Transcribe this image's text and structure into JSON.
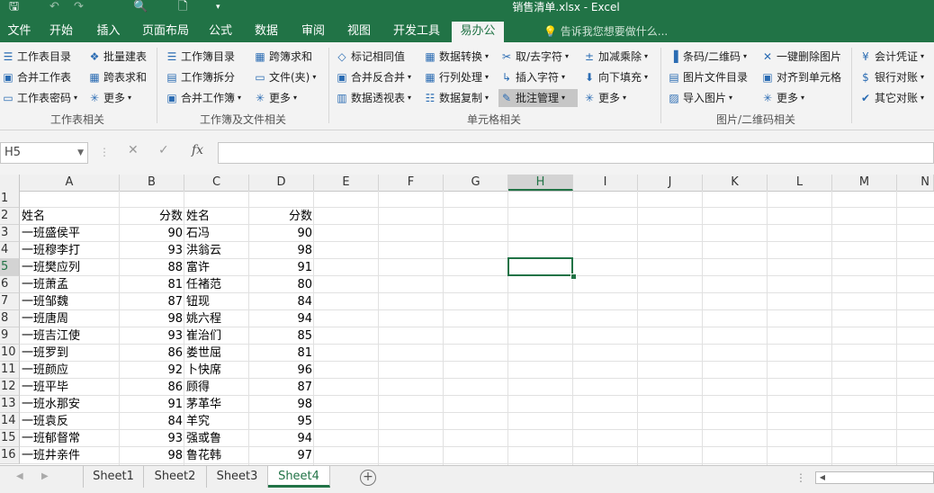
{
  "window": {
    "title": "销售清单.xlsx - Excel"
  },
  "quick_access": [
    "save-icon",
    "undo-icon",
    "redo-icon",
    "print-preview-icon",
    "new-file-icon",
    "customize-icon"
  ],
  "tabs": [
    "文件",
    "开始",
    "插入",
    "页面布局",
    "公式",
    "数据",
    "审阅",
    "视图",
    "开发工具",
    "易办公"
  ],
  "active_tab": "易办公",
  "tell_me": "告诉我您想要做什么...",
  "ribbon": {
    "group1": {
      "label": "工作表相关",
      "items": [
        "工作表目录",
        "批量建表",
        "合并工作表",
        "跨表求和",
        "工作表密码",
        "更多"
      ]
    },
    "group2": {
      "label": "工作簿及文件相关",
      "items": [
        "工作簿目录",
        "跨簿求和",
        "工作簿拆分",
        "文件(夹)",
        "合并工作簿",
        "更多"
      ]
    },
    "group3": {
      "label": "单元格相关",
      "items": [
        "标记相同值",
        "数据转换",
        "取/去字符",
        "加减乘除",
        "合并反合并",
        "行列处理",
        "插入字符",
        "向下填充",
        "数据透视表",
        "数据复制",
        "批注管理",
        "更多"
      ]
    },
    "group4": {
      "label": "图片/二维码相关",
      "items": [
        "条码/二维码",
        "一键删除图片",
        "图片文件目录",
        "对齐到单元格",
        "导入图片",
        "更多"
      ]
    },
    "group5": {
      "label": "",
      "items": [
        "会计凭证",
        "银行对账",
        "其它对账"
      ]
    }
  },
  "formula_bar": {
    "name_box": "H5",
    "formula": ""
  },
  "columns": [
    "A",
    "B",
    "C",
    "D",
    "E",
    "F",
    "G",
    "H",
    "I",
    "J",
    "K",
    "L",
    "M",
    "N"
  ],
  "selected_column": "H",
  "selected_row": "5",
  "rows": [
    {
      "num": "1",
      "a": "",
      "b": "",
      "c": "",
      "d": ""
    },
    {
      "num": "2",
      "a": "姓名",
      "b": "分数",
      "c": "姓名",
      "d": "分数"
    },
    {
      "num": "3",
      "a": "一班盛侯平",
      "b": "90",
      "c": "石冯",
      "d": "90"
    },
    {
      "num": "4",
      "a": "一班穆李打",
      "b": "93",
      "c": "洪翁云",
      "d": "98"
    },
    {
      "num": "5",
      "a": "一班樊应列",
      "b": "88",
      "c": "富许",
      "d": "91"
    },
    {
      "num": "6",
      "a": "一班萧孟",
      "b": "81",
      "c": "任褚范",
      "d": "80"
    },
    {
      "num": "7",
      "a": "一班邹魏",
      "b": "87",
      "c": "钮现",
      "d": "84"
    },
    {
      "num": "8",
      "a": "一班唐周",
      "b": "98",
      "c": "姚六程",
      "d": "94"
    },
    {
      "num": "9",
      "a": "一班吉江使",
      "b": "93",
      "c": "崔治们",
      "d": "85"
    },
    {
      "num": "10",
      "a": "一班罗到",
      "b": "86",
      "c": "娄世屈",
      "d": "81"
    },
    {
      "num": "11",
      "a": "一班颜应",
      "b": "92",
      "c": "卜快席",
      "d": "96"
    },
    {
      "num": "12",
      "a": "一班平毕",
      "b": "86",
      "c": "顾得",
      "d": "87"
    },
    {
      "num": "13",
      "a": "一班水那安",
      "b": "91",
      "c": "茅革华",
      "d": "98"
    },
    {
      "num": "14",
      "a": "一班袁反",
      "b": "84",
      "c": "羊究",
      "d": "95"
    },
    {
      "num": "15",
      "a": "一班郁督常",
      "b": "93",
      "c": "强或鲁",
      "d": "94"
    },
    {
      "num": "16",
      "a": "一班井亲件",
      "b": "98",
      "c": "鲁花韩",
      "d": "97"
    }
  ],
  "sheets": [
    "Sheet1",
    "Sheet2",
    "Sheet3",
    "Sheet4"
  ],
  "active_sheet": "Sheet4",
  "colors": {
    "accent": "#217346",
    "ribbon_bg": "#f3f3f3",
    "icon_blue": "#2b6cb3"
  }
}
